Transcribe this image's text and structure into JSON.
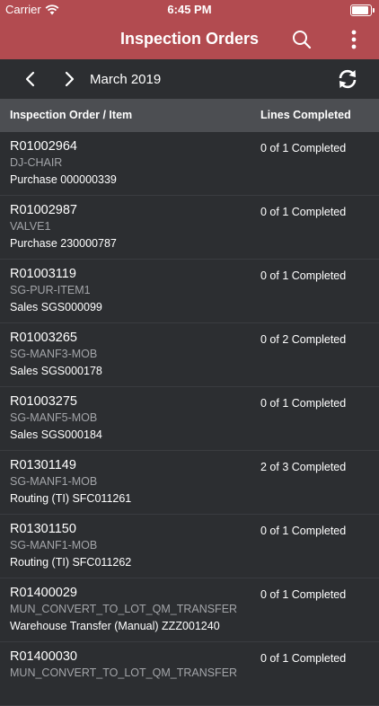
{
  "status_bar": {
    "carrier": "Carrier",
    "time": "6:45 PM",
    "battery_level": 1.0
  },
  "nav": {
    "title": "Inspection Orders"
  },
  "date_bar": {
    "month": "March 2019"
  },
  "table": {
    "columns": [
      "Inspection Order / Item",
      "Lines Completed"
    ],
    "rows": [
      {
        "order": "R01002964",
        "item": "DJ-CHAIR",
        "type": "Purchase  000000339",
        "lines": "0 of 1 Completed"
      },
      {
        "order": "R01002987",
        "item": "VALVE1",
        "type": "Purchase  230000787",
        "lines": "0 of 1 Completed"
      },
      {
        "order": "R01003119",
        "item": "SG-PUR-ITEM1",
        "type": "Sales  SGS000099",
        "lines": "0 of 1 Completed"
      },
      {
        "order": "R01003265",
        "item": "SG-MANF3-MOB",
        "type": "Sales  SGS000178",
        "lines": "0 of 2 Completed"
      },
      {
        "order": "R01003275",
        "item": "SG-MANF5-MOB",
        "type": "Sales  SGS000184",
        "lines": "0 of 1 Completed"
      },
      {
        "order": "R01301149",
        "item": "SG-MANF1-MOB",
        "type": "Routing (TI)  SFC011261",
        "lines": "2 of 3 Completed"
      },
      {
        "order": "R01301150",
        "item": "SG-MANF1-MOB",
        "type": "Routing (TI)  SFC011262",
        "lines": "0 of 1 Completed"
      },
      {
        "order": "R01400029",
        "item": "MUN_CONVERT_TO_LOT_QM_TRANSFER",
        "type": "Warehouse Transfer (Manual)  ZZZ001240",
        "lines": "0 of 1 Completed"
      },
      {
        "order": "R01400030",
        "item": "MUN_CONVERT_TO_LOT_QM_TRANSFER",
        "type": "",
        "lines": "0 of 1 Completed"
      }
    ]
  },
  "icons": {
    "wifi": "wifi-icon",
    "battery": "battery-icon",
    "search": "search-icon",
    "more": "more-vertical-icon",
    "prev": "chevron-left-icon",
    "next": "chevron-right-icon",
    "refresh": "refresh-icon"
  },
  "colors": {
    "header": "#b24b50",
    "background": "#2c2e31",
    "column_header": "#4c4e52",
    "secondary_text": "#a3a5a9"
  }
}
